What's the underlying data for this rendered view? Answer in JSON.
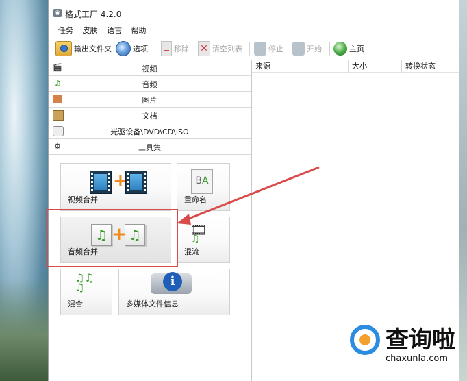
{
  "window": {
    "title": "格式工厂 4.2.0"
  },
  "menu": [
    "任务",
    "皮肤",
    "语言",
    "帮助"
  ],
  "toolbar": {
    "output_folder": "输出文件夹",
    "options": "选项",
    "remove": "移除",
    "clear_list": "清空列表",
    "stop": "停止",
    "start": "开始",
    "home": "主页"
  },
  "categories": [
    {
      "label": "视频",
      "icon": "video-icon"
    },
    {
      "label": "音频",
      "icon": "music-note-icon"
    },
    {
      "label": "图片",
      "icon": "image-icon"
    },
    {
      "label": "文档",
      "icon": "document-icon"
    },
    {
      "label": "光驱设备\\DVD\\CD\\ISO",
      "icon": "disc-drive-icon"
    },
    {
      "label": "工具集",
      "icon": "toolbox-icon"
    }
  ],
  "tools": {
    "video_merge": "视频合并",
    "rename": "重命名",
    "audio_merge": "音频合并",
    "mux": "混流",
    "mix": "混合",
    "media_info": "多媒体文件信息"
  },
  "list_columns": [
    "来源",
    "大小",
    "转换状态"
  ],
  "watermark": {
    "name": "查询啦",
    "url": "chaxunla.com"
  },
  "colors": {
    "highlight": "#d94b4b",
    "plus_orange": "#f08a1c",
    "logo_blue": "#2c8ce0"
  }
}
